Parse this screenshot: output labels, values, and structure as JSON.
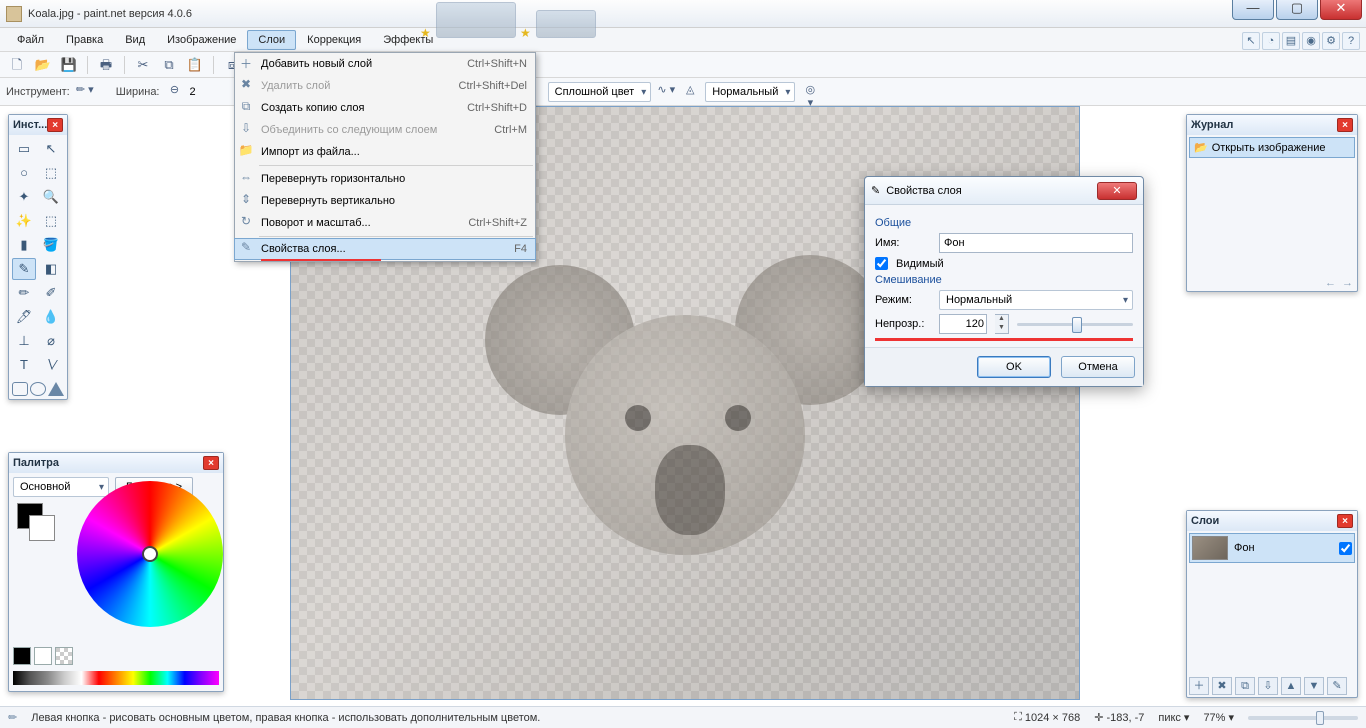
{
  "title": "Koala.jpg - paint.net версия 4.0.6",
  "menu": {
    "items": [
      "Файл",
      "Правка",
      "Вид",
      "Изображение",
      "Слои",
      "Коррекция",
      "Эффекты"
    ],
    "open_index": 4
  },
  "toolbar2": {
    "tool_label": "Инструмент:",
    "width_label": "Ширина:",
    "width_value": "2",
    "fill_label": "Сплошной цвет",
    "blend_label": "Нормальный"
  },
  "dropdown": {
    "items": [
      {
        "icon": "＋",
        "label": "Добавить новый слой",
        "shortcut": "Ctrl+Shift+N",
        "disabled": false
      },
      {
        "icon": "✖",
        "label": "Удалить слой",
        "shortcut": "Ctrl+Shift+Del",
        "disabled": true
      },
      {
        "icon": "⧉",
        "label": "Создать копию слоя",
        "shortcut": "Ctrl+Shift+D",
        "disabled": false
      },
      {
        "icon": "⇩",
        "label": "Объединить со следующим слоем",
        "shortcut": "Ctrl+M",
        "disabled": true
      },
      {
        "icon": "📁",
        "label": "Импорт из файла...",
        "shortcut": "",
        "disabled": false
      },
      {
        "sep": true
      },
      {
        "icon": "⇔",
        "label": "Перевернуть горизонтально",
        "shortcut": "",
        "disabled": false
      },
      {
        "icon": "⇕",
        "label": "Перевернуть вертикально",
        "shortcut": "",
        "disabled": false
      },
      {
        "icon": "↻",
        "label": "Поворот и масштаб...",
        "shortcut": "Ctrl+Shift+Z",
        "disabled": false
      },
      {
        "sep": true
      },
      {
        "icon": "✎",
        "label": "Свойства слоя...",
        "shortcut": "F4",
        "disabled": false,
        "hover": true,
        "underline": true
      }
    ]
  },
  "dialog": {
    "title": "Свойства слоя",
    "group_general": "Общие",
    "name_label": "Имя:",
    "name_value": "Фон",
    "visible_label": "Видимый",
    "visible_checked": true,
    "group_blend": "Смешивание",
    "mode_label": "Режим:",
    "mode_value": "Нормальный",
    "opacity_label": "Непрозр.:",
    "opacity_value": "120",
    "opacity_max": 255,
    "ok": "OK",
    "cancel": "Отмена"
  },
  "tools_title": "Инст...",
  "tools": [
    "▭",
    "↖",
    "○",
    "⬚",
    "✦",
    "🔍",
    "✨",
    "⬚",
    "▮",
    "🪣",
    "✎",
    "◧",
    "✏",
    "✐",
    "🖊",
    "💧",
    "⊥",
    "⌀",
    "T",
    "∖∕"
  ],
  "tool_selected_index": 10,
  "palette": {
    "title": "Палитра",
    "mode": "Основной",
    "more": "Больше >>"
  },
  "history": {
    "title": "Журнал",
    "item": "Открыть изображение"
  },
  "layers": {
    "title": "Слои",
    "layer_name": "Фон"
  },
  "status": {
    "hint": "Левая кнопка - рисовать основным цветом, правая кнопка - использовать дополнительным цветом.",
    "dims": "1024 × 768",
    "cursor": "-183, -7",
    "units": "пикс",
    "zoom": "77%"
  }
}
